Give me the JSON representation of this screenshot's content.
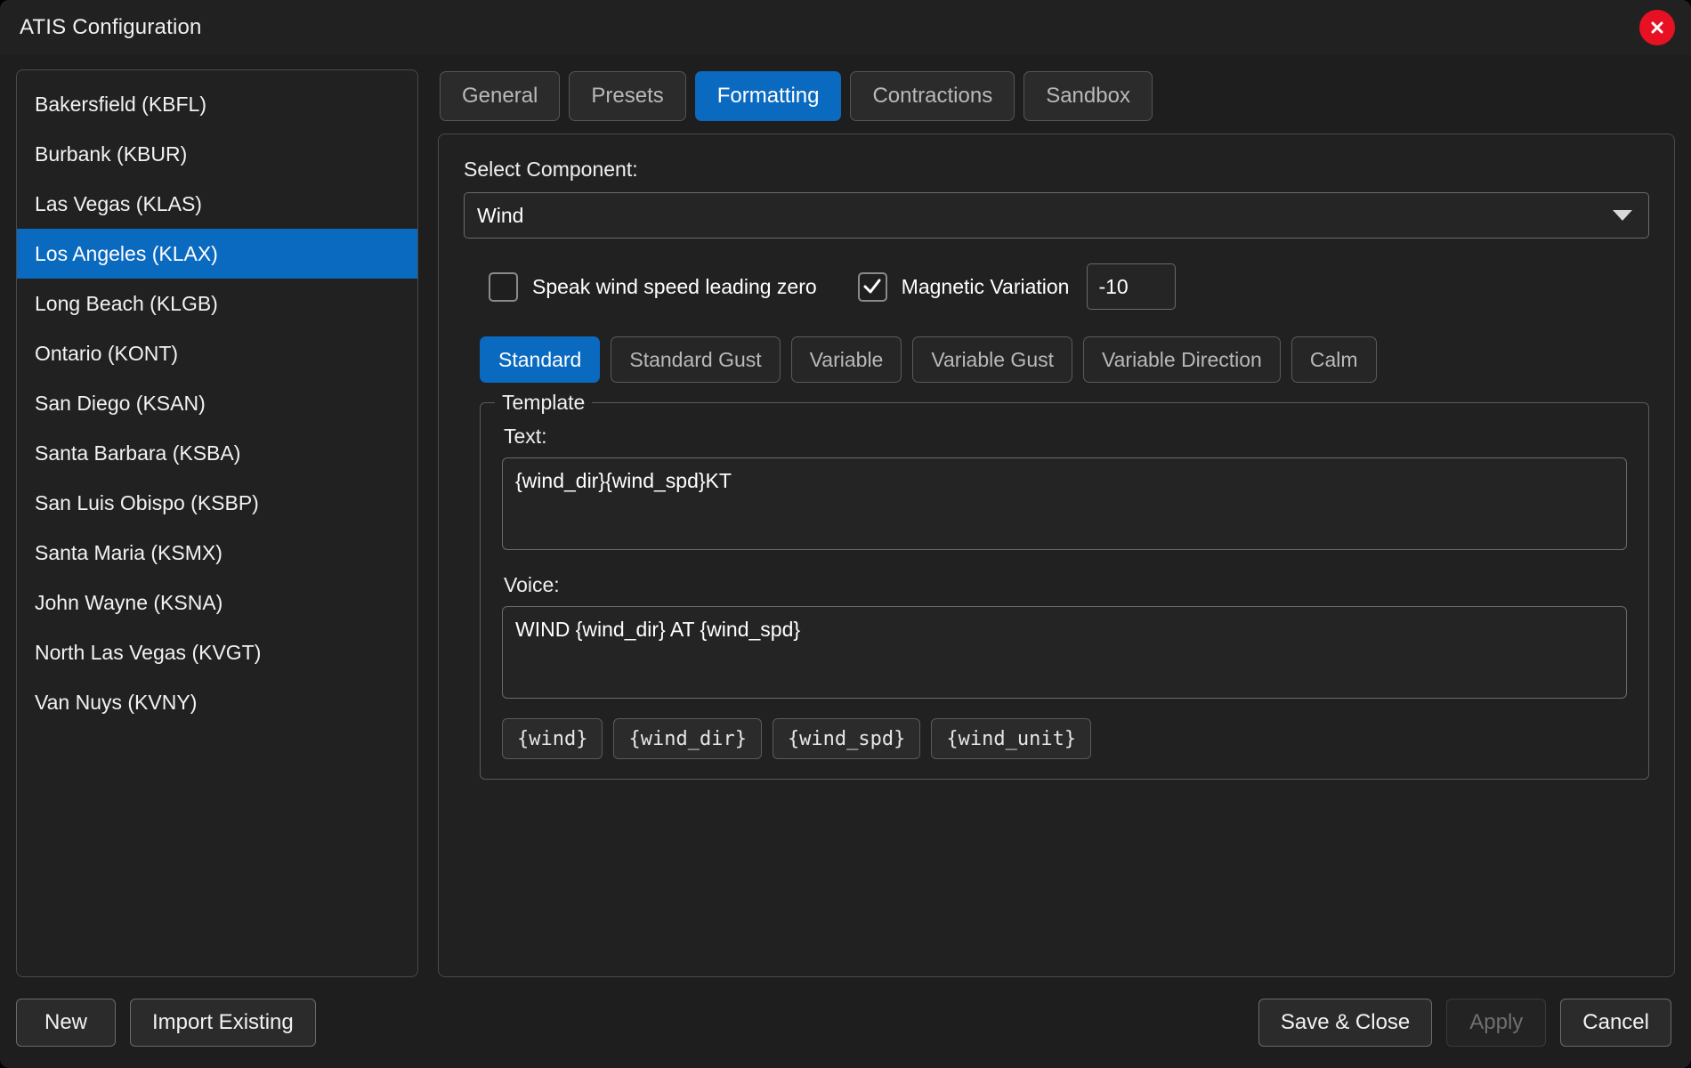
{
  "window": {
    "title": "ATIS Configuration",
    "close_icon": "close-icon",
    "accent_color": "#0a6ac0",
    "close_color": "#e81123"
  },
  "sidebar": {
    "items": [
      {
        "label": "Bakersfield (KBFL)",
        "selected": false
      },
      {
        "label": "Burbank (KBUR)",
        "selected": false
      },
      {
        "label": "Las Vegas (KLAS)",
        "selected": false
      },
      {
        "label": "Los Angeles (KLAX)",
        "selected": true
      },
      {
        "label": "Long Beach (KLGB)",
        "selected": false
      },
      {
        "label": "Ontario (KONT)",
        "selected": false
      },
      {
        "label": "San Diego (KSAN)",
        "selected": false
      },
      {
        "label": "Santa Barbara (KSBA)",
        "selected": false
      },
      {
        "label": "San Luis Obispo (KSBP)",
        "selected": false
      },
      {
        "label": "Santa Maria (KSMX)",
        "selected": false
      },
      {
        "label": "John Wayne (KSNA)",
        "selected": false
      },
      {
        "label": "North Las Vegas (KVGT)",
        "selected": false
      },
      {
        "label": "Van Nuys (KVNY)",
        "selected": false
      }
    ]
  },
  "tabs": [
    {
      "label": "General",
      "active": false
    },
    {
      "label": "Presets",
      "active": false
    },
    {
      "label": "Formatting",
      "active": true
    },
    {
      "label": "Contractions",
      "active": false
    },
    {
      "label": "Sandbox",
      "active": false
    }
  ],
  "formatting": {
    "select_component_label": "Select Component:",
    "component_value": "Wind",
    "chevron_icon": "chevron-down-icon",
    "leading_zero": {
      "label": "Speak wind speed leading zero",
      "checked": false
    },
    "magnetic_variation": {
      "label": "Magnetic Variation",
      "checked": true,
      "value": "-10"
    },
    "wind_types": [
      {
        "label": "Standard",
        "active": true
      },
      {
        "label": "Standard Gust",
        "active": false
      },
      {
        "label": "Variable",
        "active": false
      },
      {
        "label": "Variable Gust",
        "active": false
      },
      {
        "label": "Variable Direction",
        "active": false
      },
      {
        "label": "Calm",
        "active": false
      }
    ],
    "template": {
      "group_title": "Template",
      "text_label": "Text:",
      "text_value": "{wind_dir}{wind_spd}KT",
      "voice_label": "Voice:",
      "voice_value": "WIND {wind_dir} AT {wind_spd}",
      "variables": [
        "{wind}",
        "{wind_dir}",
        "{wind_spd}",
        "{wind_unit}"
      ]
    }
  },
  "footer": {
    "new_label": "New",
    "import_label": "Import Existing",
    "save_close_label": "Save & Close",
    "apply_label": "Apply",
    "cancel_label": "Cancel"
  }
}
